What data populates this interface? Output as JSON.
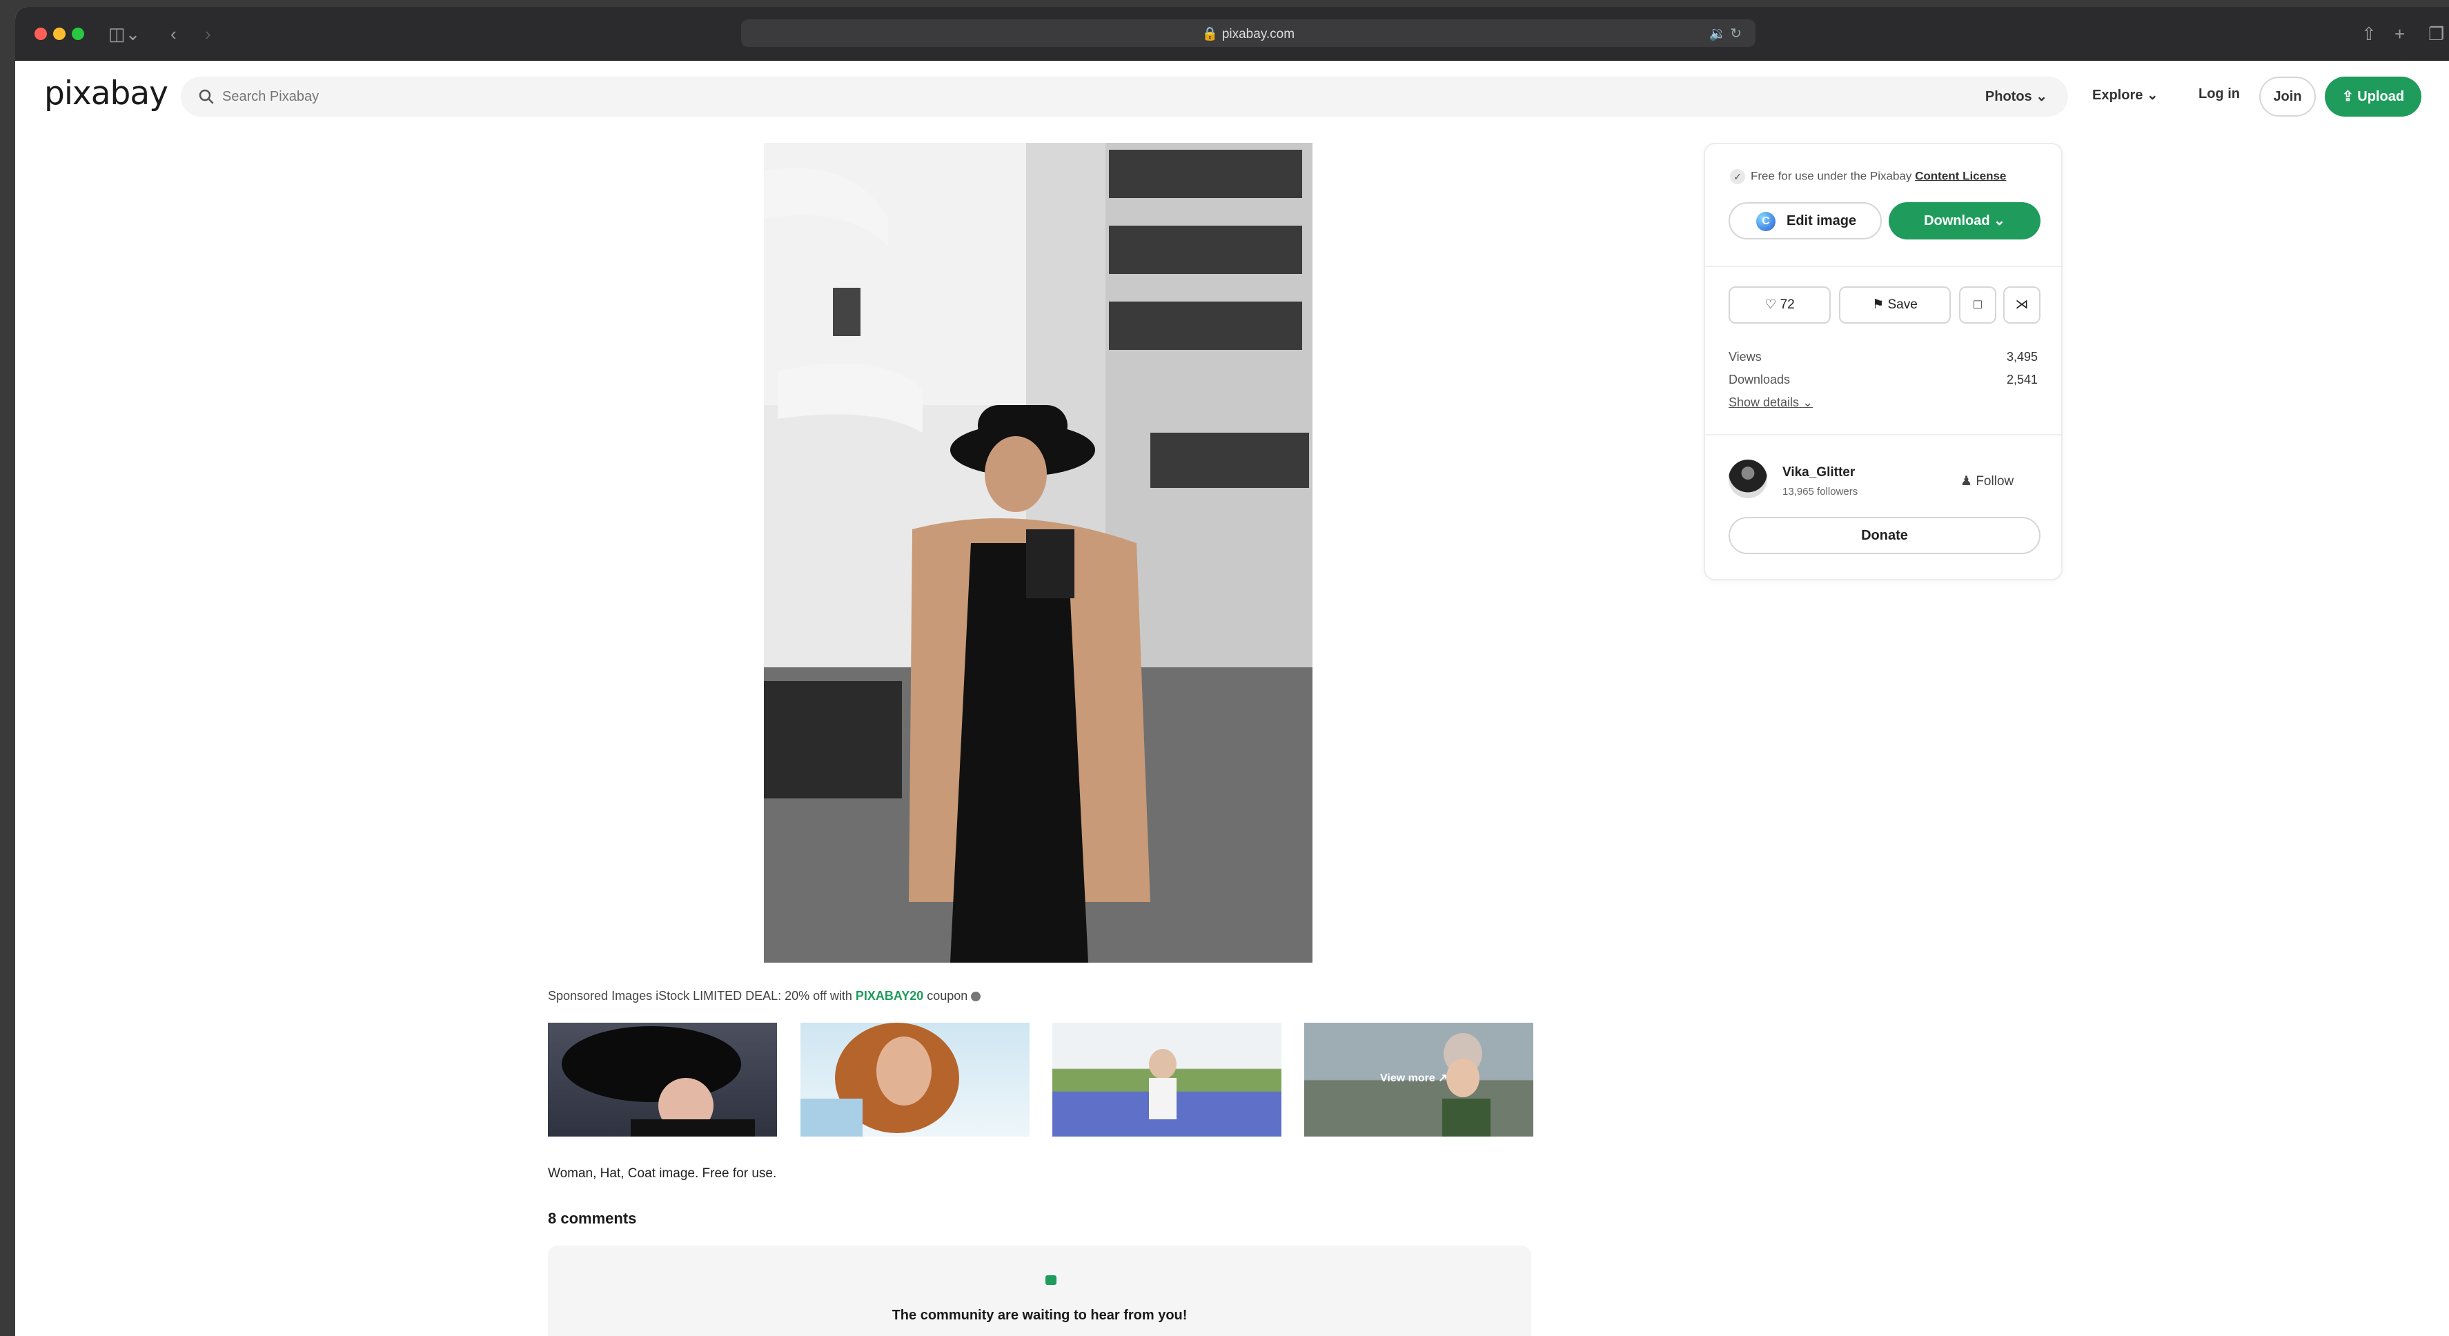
{
  "browser": {
    "url": "pixabay.com"
  },
  "header": {
    "logo": "pixabay",
    "search_placeholder": "Search Pixabay",
    "search_filter": "Photos",
    "explore": "Explore",
    "login": "Log in",
    "join": "Join",
    "upload": "Upload"
  },
  "main": {
    "sponsored_prefix": "Sponsored Images iStock LIMITED DEAL: 20% off with ",
    "coupon_code": "PIXABAY20",
    "sponsored_suffix": " coupon",
    "view_more": "View more",
    "caption": "Woman, Hat, Coat image. Free for use.",
    "comments_heading": "8 comments",
    "comments_prompt": "The community are waiting to hear from you!"
  },
  "sidebar": {
    "license_text": "Free for use under the Pixabay ",
    "license_link": "Content License",
    "edit_image": "Edit image",
    "download": "Download",
    "likes": "72",
    "save": "Save",
    "stats": {
      "views_label": "Views",
      "views_value": "3,495",
      "downloads_label": "Downloads",
      "downloads_value": "2,541"
    },
    "show_details": "Show details",
    "user": {
      "name": "Vika_Glitter",
      "followers": "13,965 followers",
      "follow": "Follow"
    },
    "donate": "Donate"
  },
  "colors": {
    "brand_green": "#1f9c5c",
    "titlebar": "#2b2b2d"
  }
}
